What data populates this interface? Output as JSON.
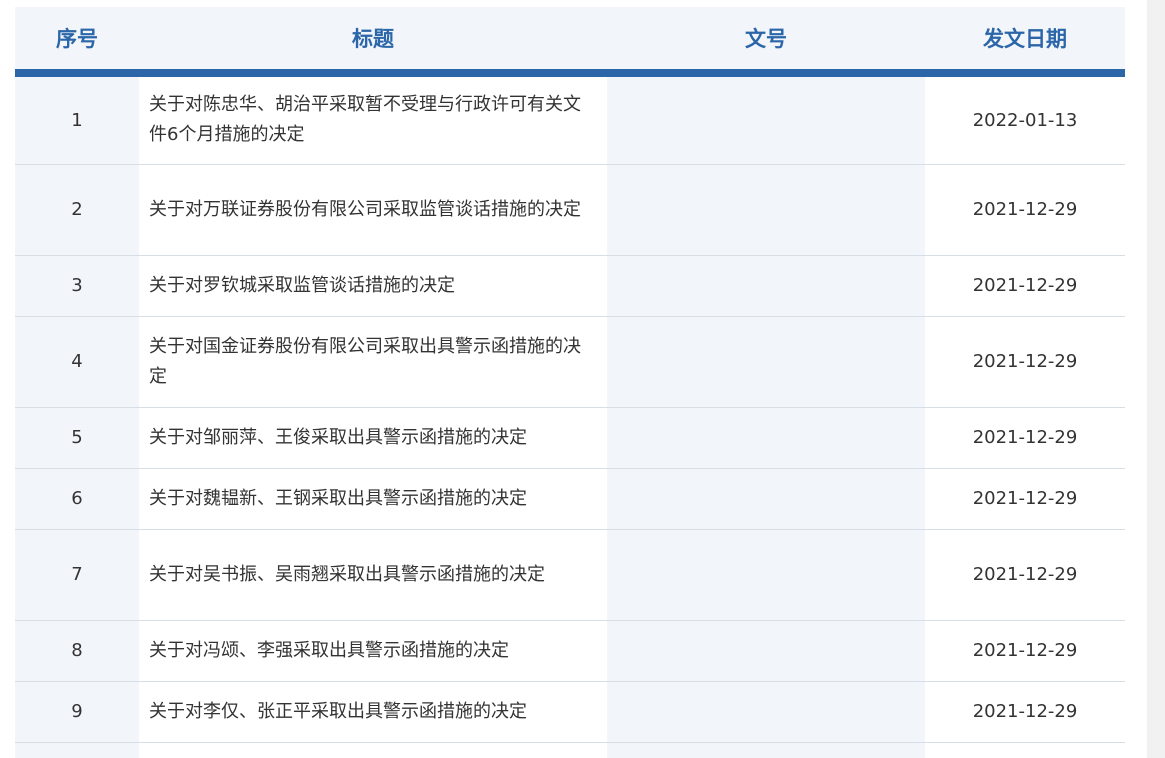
{
  "table": {
    "headers": [
      "序号",
      "标题",
      "文号",
      "发文日期"
    ],
    "rows": [
      {
        "no": "1",
        "title": "关于对陈忠华、胡治平采取暂不受理与行政许可有关文件6个月措施的决定",
        "doc_no": "",
        "date": "2022-01-13"
      },
      {
        "no": "2",
        "title": "关于对万联证券股份有限公司采取监管谈话措施的决定",
        "doc_no": "",
        "date": "2021-12-29"
      },
      {
        "no": "3",
        "title": "关于对罗钦城采取监管谈话措施的决定",
        "doc_no": "",
        "date": "2021-12-29"
      },
      {
        "no": "4",
        "title": "关于对国金证券股份有限公司采取出具警示函措施的决定",
        "doc_no": "",
        "date": "2021-12-29"
      },
      {
        "no": "5",
        "title": "关于对邹丽萍、王俊采取出具警示函措施的决定",
        "doc_no": "",
        "date": "2021-12-29"
      },
      {
        "no": "6",
        "title": "关于对魏韫新、王钢采取出具警示函措施的决定",
        "doc_no": "",
        "date": "2021-12-29"
      },
      {
        "no": "7",
        "title": "关于对吴书振、吴雨翘采取出具警示函措施的决定",
        "doc_no": "",
        "date": "2021-12-29"
      },
      {
        "no": "8",
        "title": "关于对冯颂、李强采取出具警示函措施的决定",
        "doc_no": "",
        "date": "2021-12-29"
      },
      {
        "no": "9",
        "title": "关于对李仅、张正平采取出具警示函措施的决定",
        "doc_no": "",
        "date": "2021-12-29"
      }
    ]
  },
  "colors": {
    "accent": "#2b66a8",
    "header_bg": "#f2f5fa",
    "text": "#333333"
  }
}
